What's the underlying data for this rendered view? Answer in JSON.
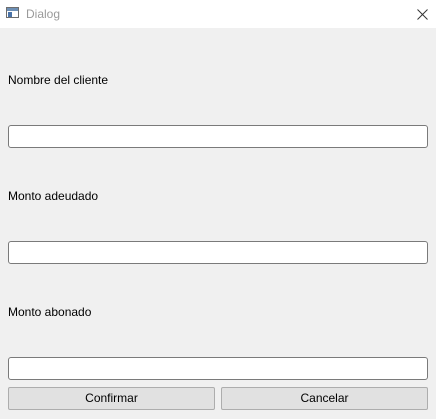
{
  "window": {
    "title": "Dialog",
    "app_icon": "window-app-icon",
    "close_icon": "close-icon"
  },
  "form": {
    "fields": [
      {
        "label": "Nombre del cliente",
        "value": "",
        "placeholder": ""
      },
      {
        "label": "Monto adeudado",
        "value": "",
        "placeholder": ""
      },
      {
        "label": "Monto abonado",
        "value": "",
        "placeholder": ""
      }
    ]
  },
  "actions": {
    "confirm_label": "Confirmar",
    "cancel_label": "Cancelar"
  }
}
